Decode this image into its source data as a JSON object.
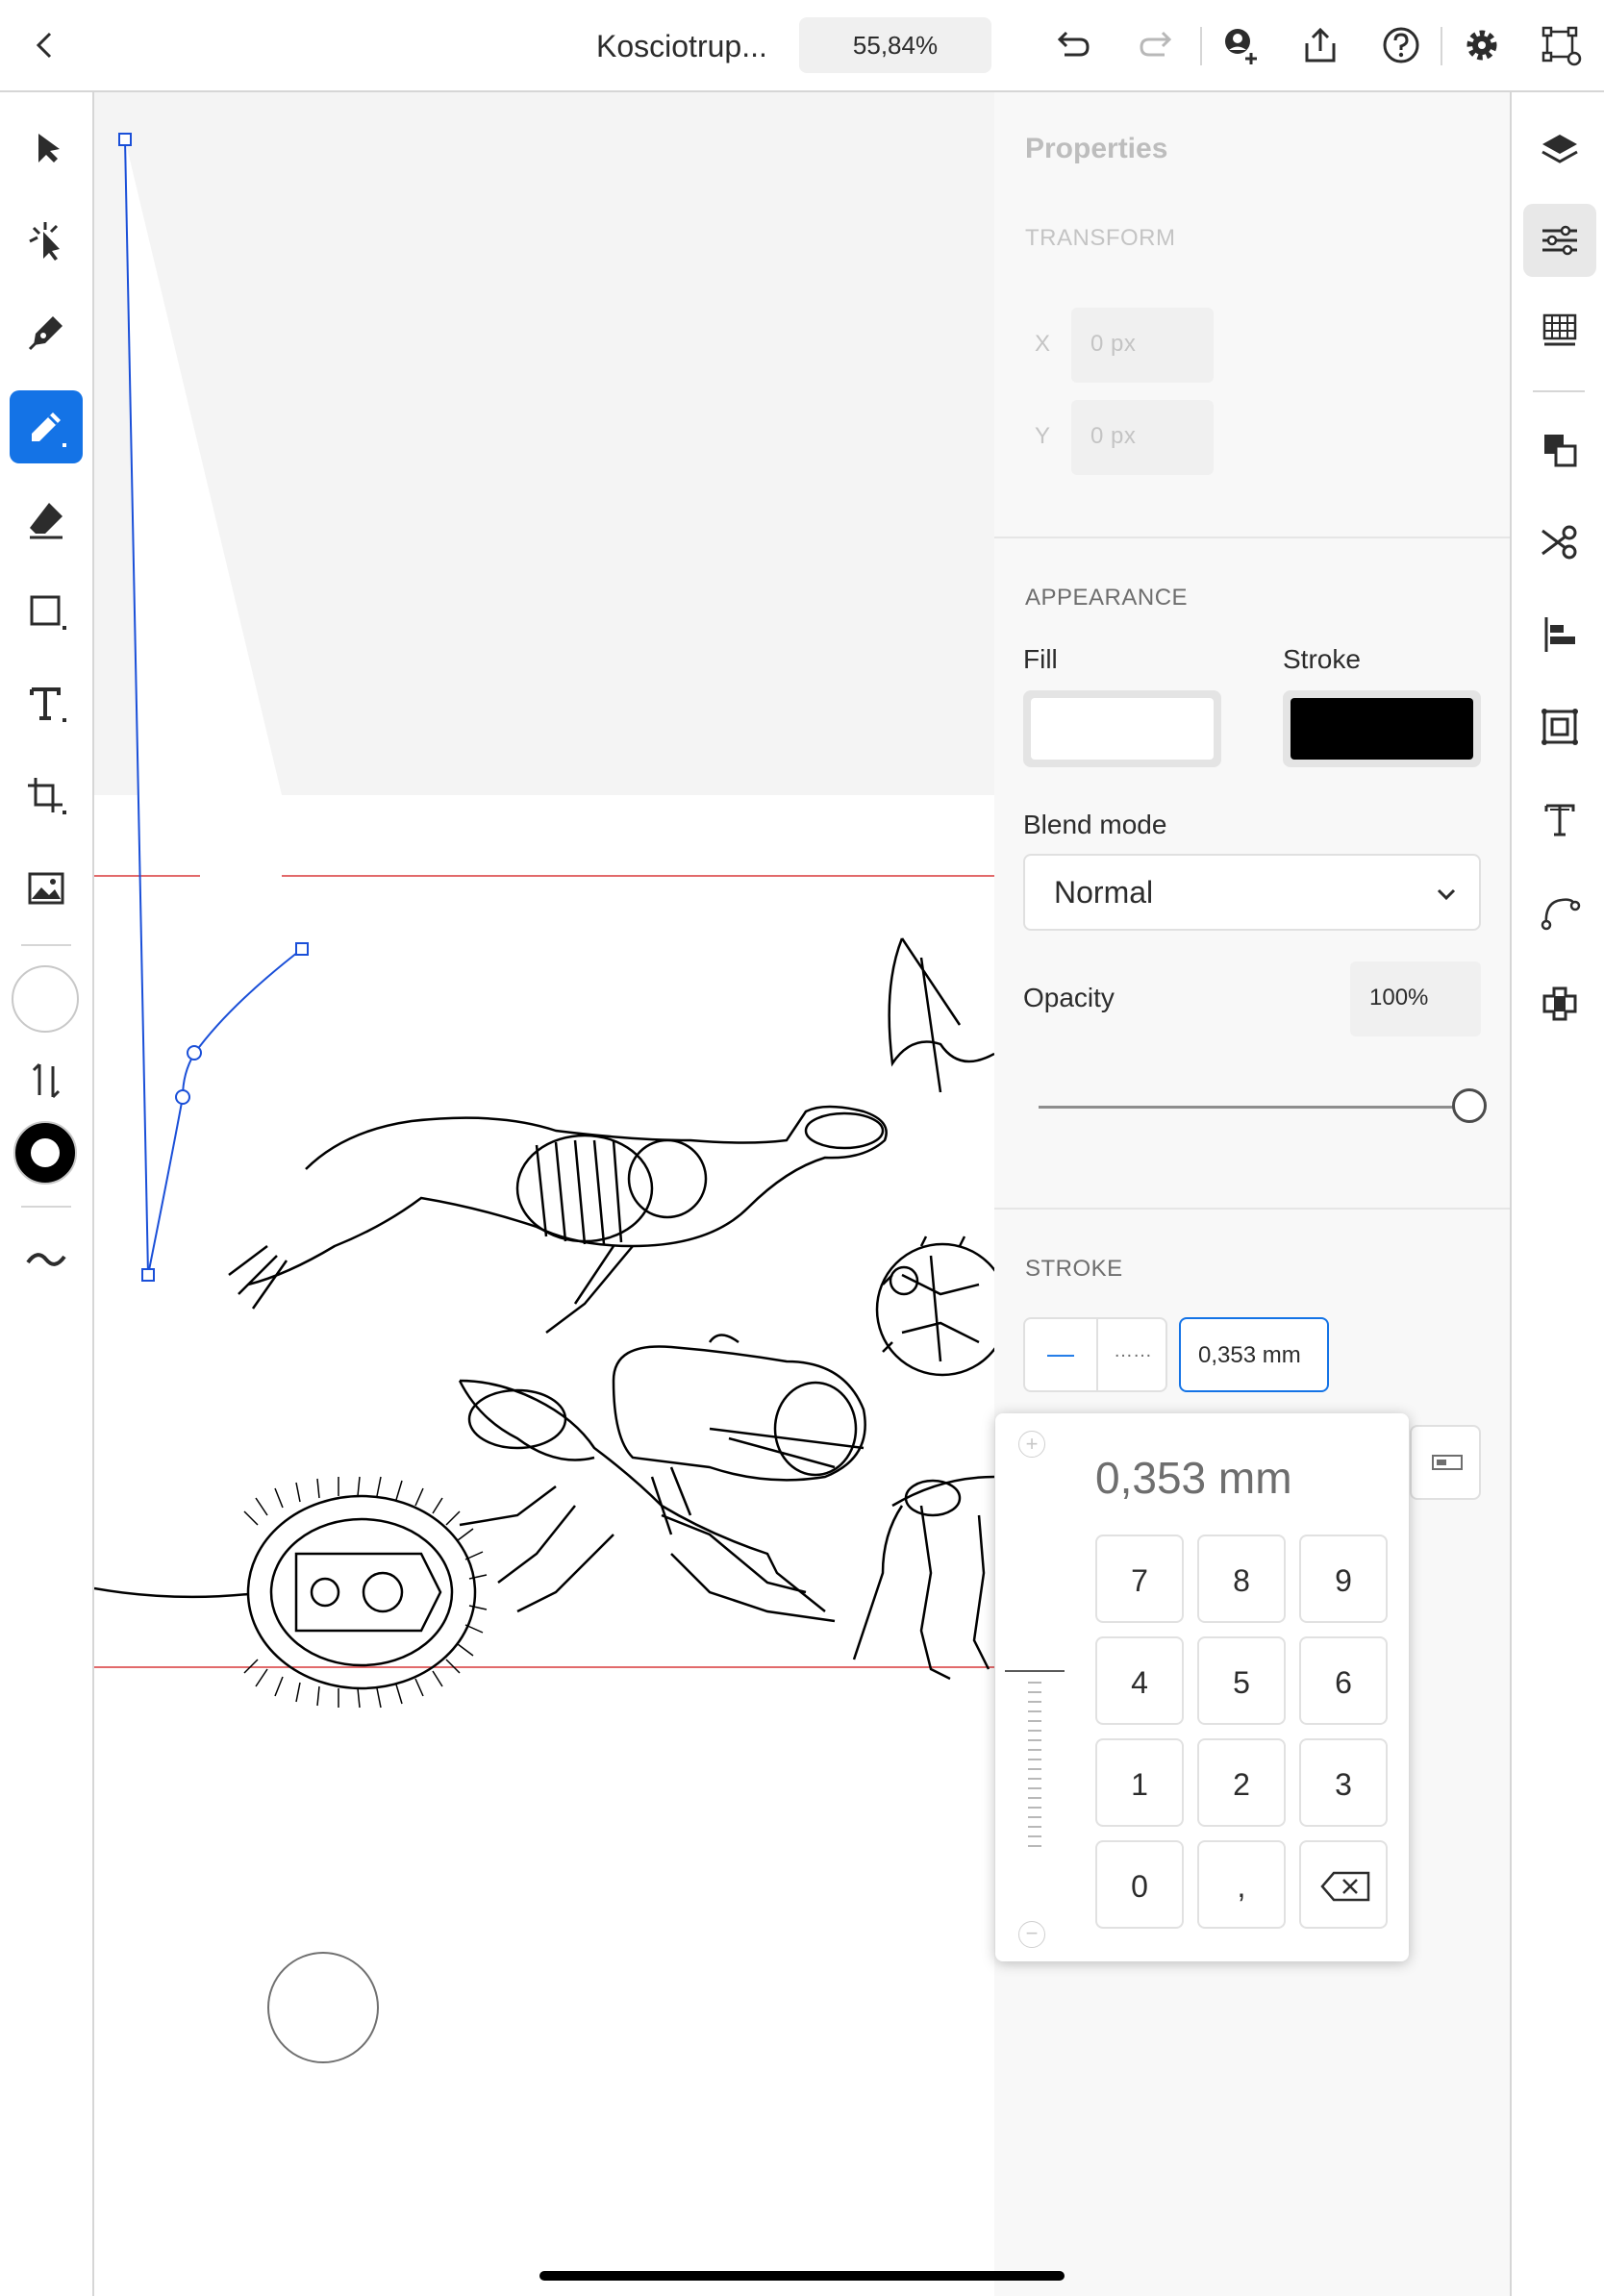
{
  "topbar": {
    "document_title": "Kosciotrup...",
    "zoom_level": "55,84%",
    "icons": [
      "back-icon",
      "undo-icon",
      "redo-icon",
      "invite-icon",
      "share-icon",
      "help-icon",
      "settings-icon",
      "selection-mode-icon"
    ]
  },
  "left_toolbar": {
    "tools": [
      "select-tool",
      "direct-select-tool",
      "pen-tool",
      "pencil-tool",
      "eraser-tool",
      "rectangle-tool",
      "type-tool",
      "crop-tool",
      "image-tool"
    ],
    "active_tool": "pencil-tool",
    "fill_swatch": "#ffffff",
    "stroke_swatch": "#000000"
  },
  "properties": {
    "title": "Properties",
    "transform": {
      "heading": "TRANSFORM",
      "x_label": "X",
      "x_value": "0 px",
      "y_label": "Y",
      "y_value": "0 px"
    },
    "appearance": {
      "heading": "APPEARANCE",
      "fill_label": "Fill",
      "fill_color": "#ffffff",
      "stroke_label": "Stroke",
      "stroke_color": "#000000",
      "blend_label": "Blend mode",
      "blend_value": "Normal",
      "opacity_label": "Opacity",
      "opacity_value": "100%",
      "opacity_fraction": 1.0
    },
    "stroke": {
      "heading": "STROKE",
      "solid_glyph": "—",
      "dashed_glyph": "……",
      "width_value": "0,353 mm"
    }
  },
  "keypad": {
    "display_value": "0,353 mm",
    "plus_label": "+",
    "minus_label": "−",
    "keys": [
      "7",
      "8",
      "9",
      "4",
      "5",
      "6",
      "1",
      "2",
      "3",
      "0",
      ","
    ],
    "backspace_icon": "backspace-icon"
  },
  "right_rail": {
    "icons": [
      "layers-icon",
      "properties-icon",
      "grid-icon",
      "arrange-icon",
      "cut-icon",
      "align-icon",
      "repeat-grid-icon",
      "type-panel-icon",
      "path-icon",
      "plugins-icon"
    ],
    "active": "properties-icon"
  },
  "colors": {
    "accent": "#1473e6",
    "artboard_guide": "#d9383a",
    "selection": "#1a4fd8"
  }
}
